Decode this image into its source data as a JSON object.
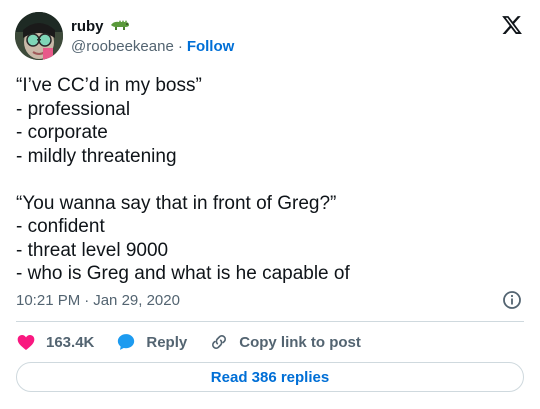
{
  "author": {
    "display_name": "ruby",
    "handle": "@roobeekeane",
    "separator": "·",
    "follow_label": "Follow",
    "emoji_icon": "crocodile-emoji-icon"
  },
  "tweet": {
    "lines": [
      "“I’ve CC’d in my boss”",
      "- professional",
      "- corporate",
      "- mildly threatening",
      "",
      "“You wanna say that in front of Greg?”",
      "- confident",
      "- threat level 9000",
      "- who is Greg and what is he capable of"
    ]
  },
  "meta": {
    "time": "10:21 PM",
    "separator": "·",
    "date": "Jan 29, 2020"
  },
  "actions": {
    "likes": "163.4K",
    "reply_label": "Reply",
    "copy_label": "Copy link to post"
  },
  "replies_button": "Read 386 replies",
  "colors": {
    "text": "#0f1419",
    "secondary": "#536471",
    "link": "#006fd6",
    "heart": "#f91880",
    "reply_bubble": "#1d9bf0",
    "border": "#cfd9de"
  }
}
